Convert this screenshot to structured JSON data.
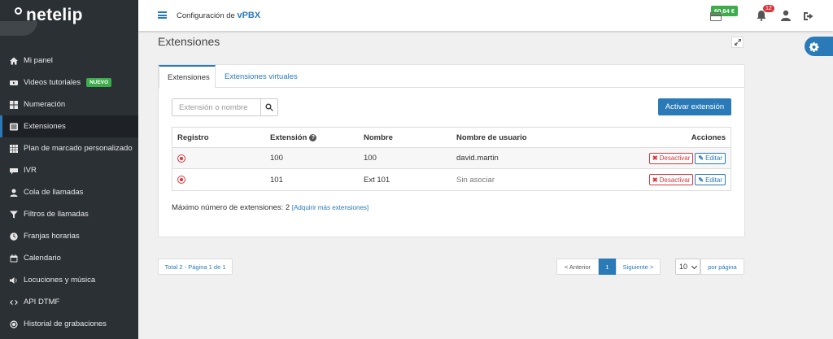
{
  "brand": {
    "logo_text": "netelip"
  },
  "sidebar": {
    "items": [
      {
        "label": "Mi panel",
        "icon": "home-icon"
      },
      {
        "label": "Videos tutoriales",
        "icon": "video-icon",
        "badge": "NUEVO"
      },
      {
        "label": "Numeración",
        "icon": "grid-icon"
      },
      {
        "label": "Extensiones",
        "icon": "list-icon",
        "active": true
      },
      {
        "label": "Plan de marcado personalizado",
        "icon": "grid-icon"
      },
      {
        "label": "IVR",
        "icon": "ivr-icon"
      },
      {
        "label": "Cola de llamadas",
        "icon": "user-icon"
      },
      {
        "label": "Filtros de llamadas",
        "icon": "filter-icon"
      },
      {
        "label": "Franjas horarias",
        "icon": "clock-icon"
      },
      {
        "label": "Calendario",
        "icon": "calendar-icon"
      },
      {
        "label": "Locuciones y música",
        "icon": "volume-icon"
      },
      {
        "label": "API DTMF",
        "icon": "code-icon"
      },
      {
        "label": "Historial de grabaciones",
        "icon": "record-icon"
      }
    ]
  },
  "topbar": {
    "title_prefix": "Configuración de",
    "title_product": "vPBX",
    "balance": "60,64 €",
    "notifications": "12"
  },
  "page": {
    "title": "Extensiones"
  },
  "tabs": [
    {
      "label": "Extensiones",
      "active": true
    },
    {
      "label": "Extensiones virtuales",
      "active": false
    }
  ],
  "search": {
    "placeholder": "Extensión o nombre",
    "value": ""
  },
  "activate_button": "Activar extensión",
  "table": {
    "headers": [
      "Registro",
      "Extensión",
      "Nombre",
      "Nombre de usuario",
      "Acciones"
    ],
    "rows": [
      {
        "extension": "100",
        "name": "100",
        "username": "david.martin",
        "status": "unregistered"
      },
      {
        "extension": "101",
        "name": "Ext 101",
        "username": "Sin asociar",
        "status": "unregistered"
      }
    ],
    "deactivate_label": "Desactivar",
    "edit_label": "Editar",
    "help_mark": "?"
  },
  "limits": {
    "text": "Máximo número de extensiones: 2",
    "link": "[Adquirir más extensiones]"
  },
  "pagination": {
    "total": "Total 2 - Página 1 de 1",
    "prev": "< Anterior",
    "current": "1",
    "next": "Siguiente >",
    "per_page_value": "10",
    "per_page_label": "por página"
  },
  "colors": {
    "accent": "#2a7ab8",
    "sidebar": "#2b3035",
    "danger": "#d9363e",
    "success": "#3cad4a"
  }
}
